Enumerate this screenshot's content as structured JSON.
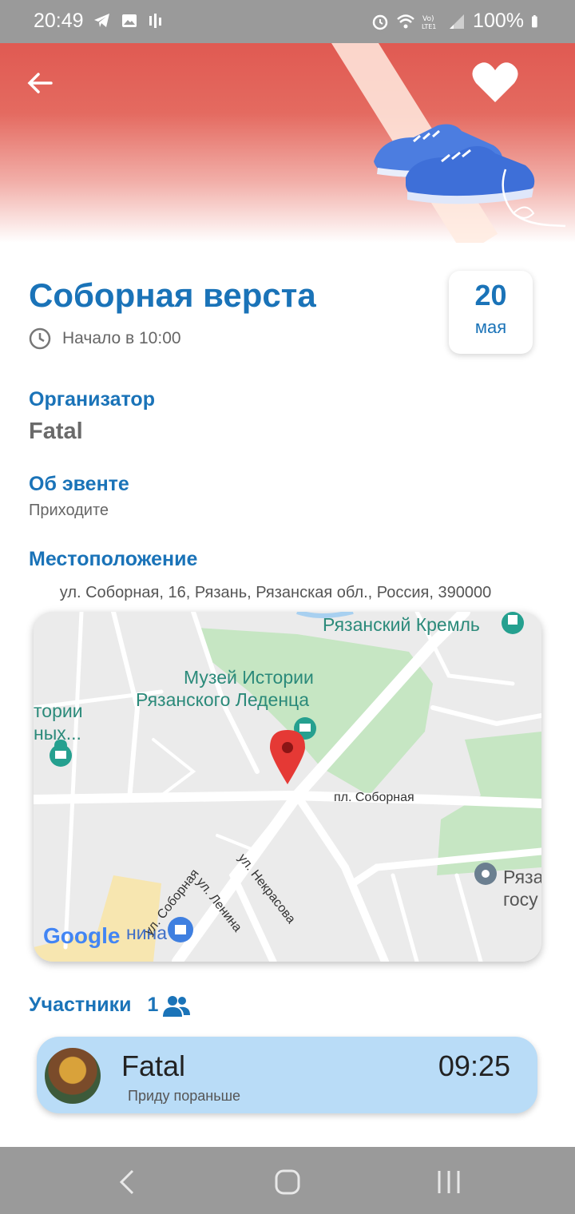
{
  "status_bar": {
    "time": "20:49",
    "battery": "100%",
    "icons": [
      "telegram-icon",
      "gallery-icon",
      "signal-bars-icon",
      "alarm-icon",
      "wifi-icon",
      "volte-icon",
      "cell-signal-icon",
      "battery-icon"
    ]
  },
  "header": {
    "back_icon": "arrow-left-icon",
    "favorite_icon": "heart-icon",
    "illustration": "sneakers-illustration"
  },
  "event": {
    "title": "Соборная верста",
    "start_text": "Начало в  10:00",
    "date_day": "20",
    "date_month": "мая"
  },
  "organizer": {
    "label": "Организатор",
    "name": "Fatal"
  },
  "about": {
    "label": "Об эвенте",
    "text": "Приходите"
  },
  "location": {
    "label": "Местоположение",
    "address": "ул. Соборная, 16, Рязань, Рязанская обл., Россия, 390000",
    "map": {
      "labels": {
        "kremlin": "Рязанский Кремль",
        "museum_line1": "Музей Истории",
        "museum_line2": "Рязанского Леденца",
        "left_poi_line1": "тории",
        "left_poi_line2": "ных...",
        "right_poi_line1": "Ряза",
        "right_poi_line2": "госу",
        "lenina_poi": "нина",
        "google": "Google"
      },
      "streets": {
        "sobornaya_square": "пл. Соборная",
        "nekrasova": "ул. Некрасова",
        "sobornaya": "ул. Соборная",
        "lenina": "ул. Ленина"
      }
    }
  },
  "participants": {
    "label": "Участники",
    "count": "1",
    "items": [
      {
        "name": "Fatal",
        "note": "Приду пораньше",
        "time": "09:25"
      }
    ]
  },
  "colors": {
    "accent": "#1a73b8",
    "header_red": "#e05a52",
    "participant_bg": "#b9dcf7",
    "park_green": "#c6e6c3"
  }
}
